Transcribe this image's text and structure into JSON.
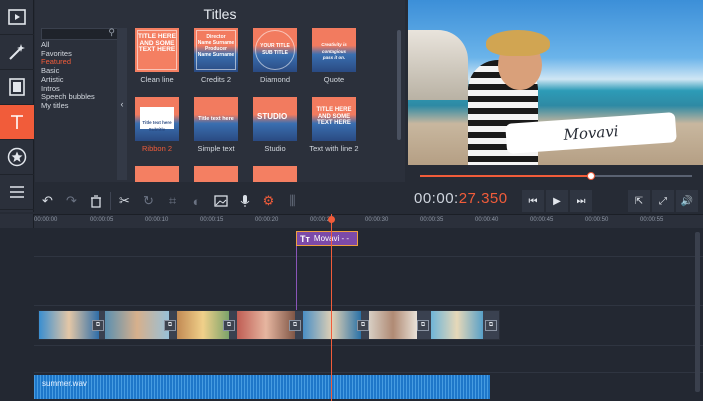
{
  "app": {
    "accent": "#f15c3a"
  },
  "leftbar": {
    "items": [
      {
        "name": "import",
        "icon": "film-import-icon"
      },
      {
        "name": "filters",
        "icon": "magic-wand-icon"
      },
      {
        "name": "transitions",
        "icon": "film-strip-icon"
      },
      {
        "name": "titles",
        "icon": "text-t-icon",
        "active": true
      },
      {
        "name": "stickers",
        "icon": "star-icon"
      },
      {
        "name": "more",
        "icon": "menu-icon"
      }
    ]
  },
  "titles_panel": {
    "heading": "Titles",
    "search_placeholder": "",
    "categories": [
      "All",
      "Favorites",
      "Featured",
      "Basic",
      "Artistic",
      "Intros",
      "Speech bubbles",
      "My titles"
    ],
    "selected_category": "Featured",
    "thumbs": [
      {
        "label": "Clean line",
        "art": "TITLE HERE\nAND SOME TEXT HERE"
      },
      {
        "label": "Credits 2",
        "art": "Director\nName Surname\nProducer\nName Surname"
      },
      {
        "label": "Diamond",
        "art": "YOUR TITLE\nSUB TITLE"
      },
      {
        "label": "Quote",
        "art": "Creativity is contagious\npass it on."
      },
      {
        "label": "Ribbon 2",
        "art": "Title text here\nSubtitle",
        "selected": true
      },
      {
        "label": "Simple text",
        "art": "Title text here"
      },
      {
        "label": "Studio",
        "art": "STUDIO"
      },
      {
        "label": "Text with line 2",
        "art": "TITLE HERE\nAND SOME TEXT HERE"
      }
    ]
  },
  "preview": {
    "overlay_text": "Movavi",
    "seek_progress": 0.63
  },
  "playback": {
    "timecode_main": "00:00:",
    "timecode_ms": "27.350"
  },
  "toolbar": {
    "tools": [
      {
        "name": "undo",
        "icon": "undo-icon"
      },
      {
        "name": "redo",
        "icon": "redo-icon",
        "disabled": true
      },
      {
        "name": "delete",
        "icon": "trash-icon"
      },
      {
        "name": "cut",
        "icon": "scissors-icon"
      },
      {
        "name": "rotate",
        "icon": "rotate-icon",
        "disabled": true
      },
      {
        "name": "crop",
        "icon": "crop-icon",
        "disabled": true
      },
      {
        "name": "color",
        "icon": "color-adjust-icon",
        "disabled": true
      },
      {
        "name": "image",
        "icon": "image-icon"
      },
      {
        "name": "record",
        "icon": "microphone-icon"
      },
      {
        "name": "settings",
        "icon": "gear-icon"
      },
      {
        "name": "equalizer",
        "icon": "equalizer-icon",
        "disabled": true
      }
    ]
  },
  "timeline": {
    "ticks": [
      "00:00:00",
      "00:00:05",
      "00:00:10",
      "00:00:15",
      "00:00:20",
      "00:00:25",
      "00:00:30",
      "00:00:35",
      "00:00:40",
      "00:00:45",
      "00:00:50",
      "00:00:55"
    ],
    "title_clip_label": "Movavi - -",
    "title_clip_icon": "Tт",
    "audio_clip_label": "summer.wav"
  }
}
